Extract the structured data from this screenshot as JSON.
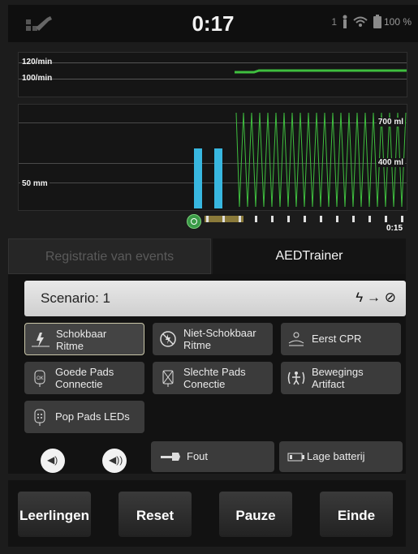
{
  "status": {
    "time": "0:17",
    "signal": "1",
    "battery": "100 %"
  },
  "rate_panel": {
    "upper": "120/min",
    "lower": "100/min"
  },
  "graph_panel": {
    "depth_label": "50 mm",
    "vol_high": "700 ml",
    "vol_low": "400 ml"
  },
  "timeline": {
    "end_label": "0:15"
  },
  "tabs": {
    "events": "Registratie van events",
    "aed": "AEDTrainer"
  },
  "scenario": {
    "label": "Scenario: 1",
    "symbol": "→"
  },
  "options": [
    {
      "line1": "Schokbaar",
      "line2": "Ritme",
      "icon": "shockable-icon"
    },
    {
      "line1": "Niet-Schokbaar",
      "line2": "Ritme",
      "icon": "no-shock-icon"
    },
    {
      "line1": "Eerst CPR",
      "line2": "",
      "icon": "cpr-icon"
    },
    {
      "line1": "Goede Pads",
      "line2": "Connectie",
      "icon": "pads-icon"
    },
    {
      "line1": "Slechte Pads",
      "line2": "Conectie",
      "icon": "bad-pads-icon"
    },
    {
      "line1": "Bewegings",
      "line2": "Artifact",
      "icon": "motion-icon"
    },
    {
      "line1": "Pop Pads LEDs",
      "line2": "",
      "icon": "pop-pads-icon"
    }
  ],
  "faults": {
    "fout": "Fout",
    "battery": "Lage batterij"
  },
  "bottom": {
    "students": "Leerlingen",
    "reset": "Reset",
    "pause": "Pauze",
    "end": "Einde"
  },
  "colors": {
    "green": "#3fbf3f",
    "blue_bar": "#38b7e0",
    "accent": "#c9c6a8"
  }
}
